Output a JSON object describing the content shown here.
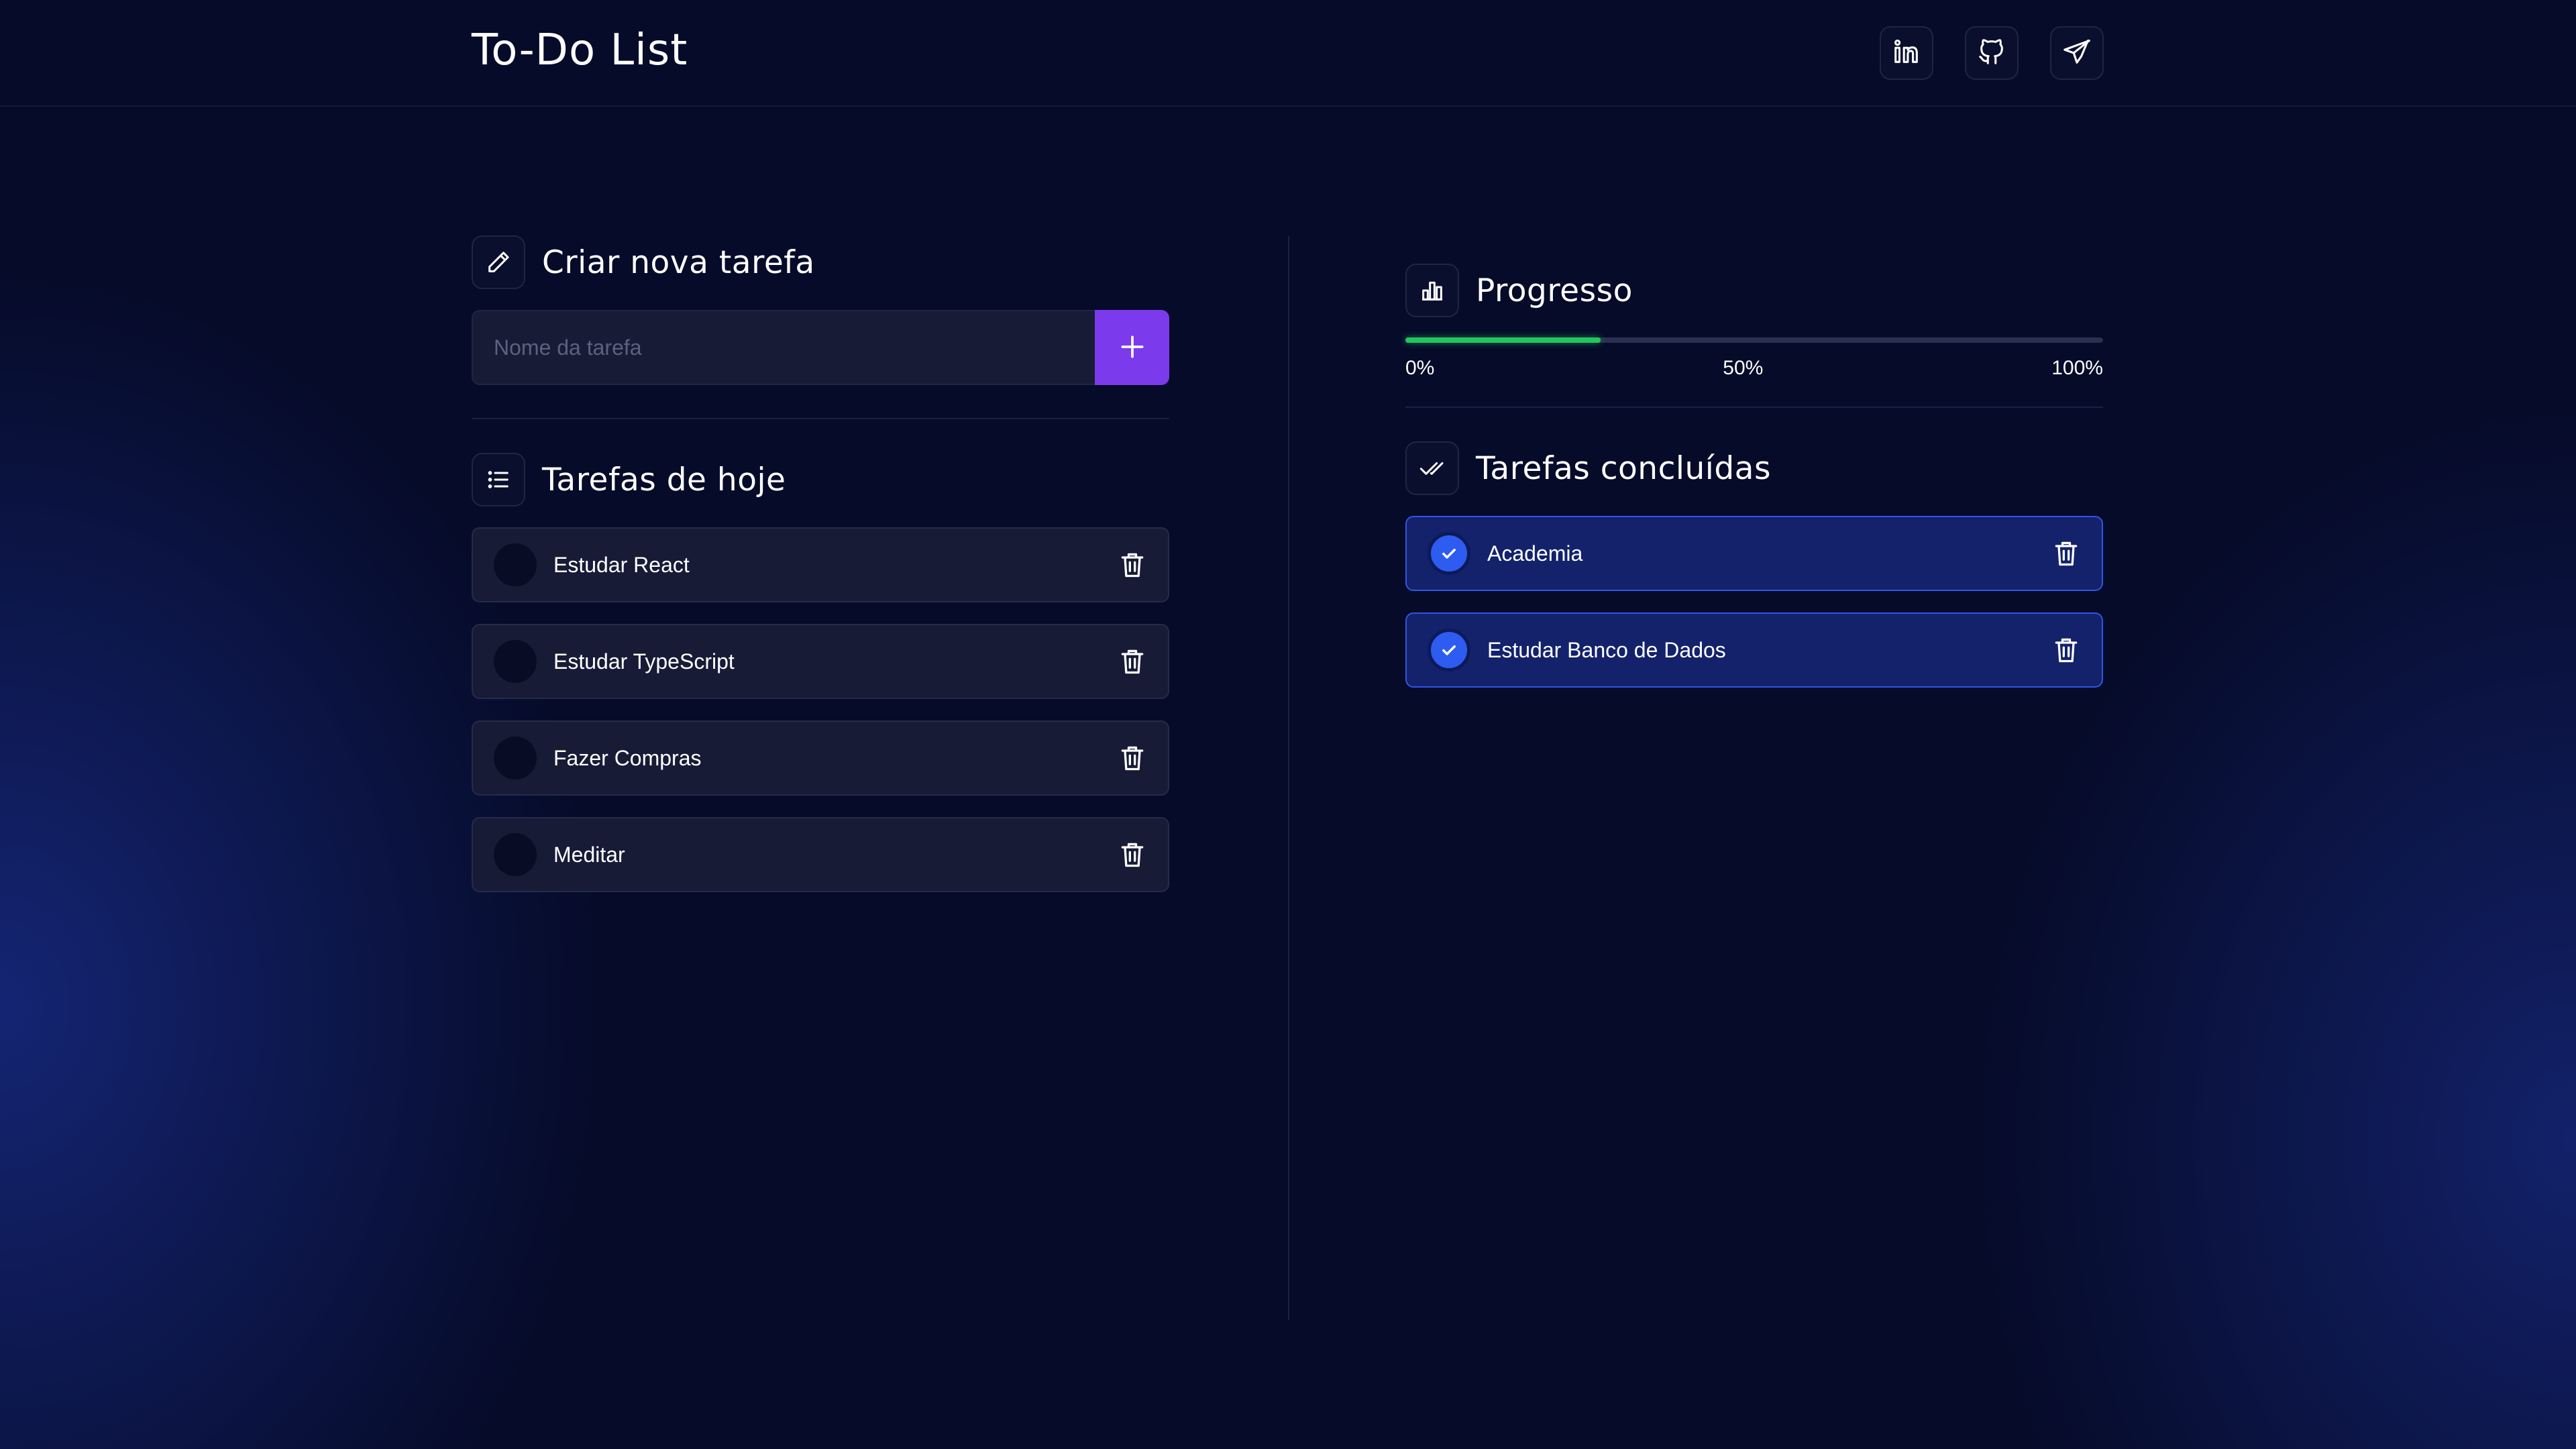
{
  "header": {
    "title": "To-Do List",
    "links": [
      {
        "name": "linkedin-icon"
      },
      {
        "name": "github-icon"
      },
      {
        "name": "telegram-icon"
      }
    ]
  },
  "create": {
    "title": "Criar nova tarefa",
    "icon": "pencil-icon",
    "input_value": "",
    "input_placeholder": "Nome da tarefa",
    "add_icon": "plus-icon"
  },
  "today": {
    "title": "Tarefas de hoje",
    "icon": "list-icon",
    "items": [
      {
        "label": "Estudar React",
        "done": false
      },
      {
        "label": "Estudar TypeScript",
        "done": false
      },
      {
        "label": "Fazer Compras",
        "done": false
      },
      {
        "label": "Meditar",
        "done": false
      }
    ]
  },
  "progress": {
    "title": "Progresso",
    "icon": "bar-chart-icon",
    "value": 0.28,
    "labels": [
      "0%",
      "50%",
      "100%"
    ]
  },
  "completed": {
    "title": "Tarefas concluídas",
    "icon": "double-check-icon",
    "items": [
      {
        "label": "Academia",
        "done": true
      },
      {
        "label": "Estudar Banco de Dados",
        "done": true
      }
    ]
  },
  "colors": {
    "background": "#060b29",
    "accent": "#7c3aed",
    "progress": "#22c55e",
    "done_border": "#2f56e6",
    "done_bg": "#13226b"
  }
}
